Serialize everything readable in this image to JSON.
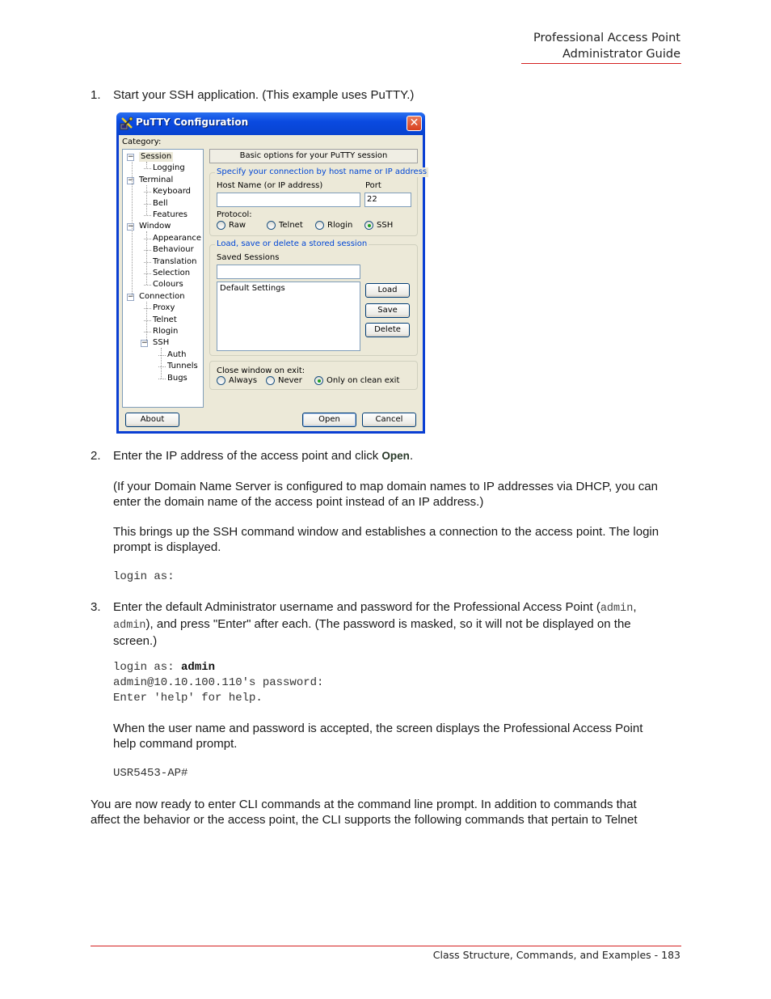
{
  "header": {
    "line1": "Professional Access Point",
    "line2": "Administrator Guide"
  },
  "footer": {
    "text": "Class Structure, Commands, and Examples - 183"
  },
  "steps": [
    {
      "number": "1.",
      "text": "Start your SSH application. (This example uses PuTTY.)"
    },
    {
      "number": "2.",
      "text_before": "Enter the IP address of the access point and click ",
      "emphasis": "Open",
      "text_after": ".",
      "note_1_line1": "(If your Domain Name Server is configured to map domain names to IP addresses via DHCP, you can",
      "note_1_line2": "enter the domain name of the access point instead of an IP address.)",
      "note_2_line1": "This brings up the SSH command window and establishes a connection to the access point. The login",
      "note_2_line2": "prompt is displayed.",
      "code": "login as:"
    },
    {
      "number": "3.",
      "line1_before": "Enter the default Administrator username and password for the Professional Access Point (",
      "code_user": "admin",
      "line1_after": ",",
      "code_pass": "admin",
      "line2_after": "), and press \"Enter\" after each. (The password is masked, so it will not be displayed on the",
      "line3": "screen.)",
      "code_line1_prefix": "login as: ",
      "code_line1_bold": "admin",
      "code_line2": "admin@10.10.100.110's password:",
      "code_line3": "Enter 'help' for help.",
      "result_line1": "When the user name and password is accepted, the screen displays the Professional Access Point",
      "result_line2": "help command prompt.",
      "prompt": "USR5453-AP#"
    }
  ],
  "closing": {
    "line1": "You are now ready to enter CLI commands at the command line prompt. In addition to commands that",
    "line2": "affect the behavior or the access point, the CLI supports the following commands that pertain to Telnet"
  },
  "putty": {
    "title": "PuTTY Configuration",
    "category_label": "Category:",
    "tree": [
      {
        "label": "Session",
        "level": 0,
        "expanded": true,
        "selected": true
      },
      {
        "label": "Logging",
        "level": 1
      },
      {
        "label": "Terminal",
        "level": 0,
        "expanded": true
      },
      {
        "label": "Keyboard",
        "level": 1
      },
      {
        "label": "Bell",
        "level": 1
      },
      {
        "label": "Features",
        "level": 1
      },
      {
        "label": "Window",
        "level": 0,
        "expanded": true
      },
      {
        "label": "Appearance",
        "level": 1
      },
      {
        "label": "Behaviour",
        "level": 1
      },
      {
        "label": "Translation",
        "level": 1
      },
      {
        "label": "Selection",
        "level": 1
      },
      {
        "label": "Colours",
        "level": 1
      },
      {
        "label": "Connection",
        "level": 0,
        "expanded": true
      },
      {
        "label": "Proxy",
        "level": 1
      },
      {
        "label": "Telnet",
        "level": 1
      },
      {
        "label": "Rlogin",
        "level": 1
      },
      {
        "label": "SSH",
        "level": 1,
        "expanded": true
      },
      {
        "label": "Auth",
        "level": 2
      },
      {
        "label": "Tunnels",
        "level": 2
      },
      {
        "label": "Bugs",
        "level": 2
      }
    ],
    "section_title": "Basic options for your PuTTY session",
    "connection_group": "Specify your connection by host name or IP address",
    "host_label": "Host Name (or IP address)",
    "host_value": "",
    "port_label": "Port",
    "port_value": "22",
    "protocol_label": "Protocol:",
    "protocols": [
      "Raw",
      "Telnet",
      "Rlogin",
      "SSH"
    ],
    "protocol_selected": "SSH",
    "sessions_group": "Load, save or delete a stored session",
    "saved_sessions_label": "Saved Sessions",
    "saved_sessions_value": "",
    "sessions_list": [
      "Default Settings"
    ],
    "load_label": "Load",
    "save_label": "Save",
    "delete_label": "Delete",
    "close_label": "Close window on exit:",
    "close_options": [
      "Always",
      "Never",
      "Only on clean exit"
    ],
    "close_selected": "Only on clean exit",
    "about_label": "About",
    "open_label": "Open",
    "cancel_label": "Cancel"
  }
}
